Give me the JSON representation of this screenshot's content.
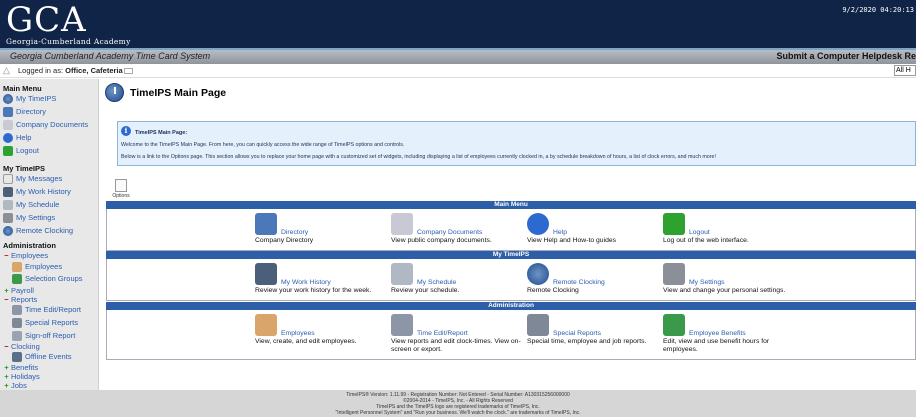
{
  "header": {
    "logo_mark": "GCA",
    "logo_sub": "Georgia-Cumberland Academy",
    "datetime": "9/2/2020 04:20:13",
    "system_title": "Georgia Cumberland Academy Time Card System",
    "helpdesk_link": "Submit a Computer Helpdesk Re"
  },
  "status": {
    "logged_in_prefix": "Logged in as:",
    "logged_in_name": "Office, Cafeteria",
    "filter_value": "All H"
  },
  "sidebar": {
    "main_menu_title": "Main Menu",
    "main_menu": [
      {
        "label": "My TimeIPS",
        "icon": "clock-icon"
      },
      {
        "label": "Directory",
        "icon": "directory-icon"
      },
      {
        "label": "Company Documents",
        "icon": "documents-icon"
      },
      {
        "label": "Help",
        "icon": "help-icon"
      },
      {
        "label": "Logout",
        "icon": "logout-icon"
      }
    ],
    "my_timeips_title": "My TimeIPS",
    "my_timeips": [
      {
        "label": "My Messages",
        "icon": "messages-icon"
      },
      {
        "label": "My Work History",
        "icon": "work-history-icon"
      },
      {
        "label": "My Schedule",
        "icon": "schedule-icon"
      },
      {
        "label": "My Settings",
        "icon": "settings-icon"
      },
      {
        "label": "Remote Clocking",
        "icon": "clock-icon"
      }
    ],
    "admin_title": "Administration",
    "employees": "Employees",
    "employees_sub": "Employees",
    "selection_groups": "Selection Groups",
    "payroll": "Payroll",
    "reports": "Reports",
    "time_edit_report": "Time Edit/Report",
    "special_reports": "Special Reports",
    "signoff_report": "Sign-off Report",
    "clocking": "Clocking",
    "offline_events": "Offline Events",
    "benefits": "Benefits",
    "holidays": "Holidays",
    "jobs": "Jobs"
  },
  "main": {
    "page_title": "TimeIPS Main Page",
    "info_head": "TimeIPS Main Page:",
    "info_line1": "Welcome to the TimeIPS Main Page.  From here, you can quickly access the wide range of TimeIPS options and controls.",
    "info_line2": "Below is a link to the Options page.  This section allows you to replace your home page with a customized set of widgets, including displaying a list of employees currently clocked in, a by schedule breakdown of hours, a list of clock errors, and much more!",
    "options_label": "Options",
    "sections": [
      {
        "title": "Main Menu",
        "tiles": [
          {
            "link": "Directory",
            "desc": "Company Directory",
            "icon": "directory-icon"
          },
          {
            "link": "Company Documents",
            "desc": "View public company documents.",
            "icon": "documents-icon"
          },
          {
            "link": "Help",
            "desc": "View Help and How-to guides",
            "icon": "help-icon"
          },
          {
            "link": "Logout",
            "desc": "Log out of the web interface.",
            "icon": "logout-icon"
          }
        ]
      },
      {
        "title": "My TimeIPS",
        "tiles": [
          {
            "link": "My Work History",
            "desc": "Review your work history for the week.",
            "icon": "work-history-icon"
          },
          {
            "link": "My Schedule",
            "desc": "Review your schedule.",
            "icon": "schedule-icon"
          },
          {
            "link": "Remote Clocking",
            "desc": "Remote Clocking",
            "icon": "clock-icon"
          },
          {
            "link": "My Settings",
            "desc": "View and change your personal settings.",
            "icon": "settings-icon"
          }
        ]
      },
      {
        "title": "Administration",
        "tiles": [
          {
            "link": "Employees",
            "desc": "View, create, and edit employees.",
            "icon": "employees-icon"
          },
          {
            "link": "Time Edit/Report",
            "desc": "View reports and edit clock-times. View on-screen or export.",
            "icon": "time-edit-icon"
          },
          {
            "link": "Special Reports",
            "desc": "Special time, employee and job reports.",
            "icon": "special-reports-icon"
          },
          {
            "link": "Employee Benefits",
            "desc": "Edit, view and use benefit hours for employees.",
            "icon": "benefits-icon"
          }
        ]
      }
    ]
  },
  "footer": {
    "line1": "TimeIPS® Version: 1.11.99 - Registration Number: Not Entered - Serial Number: A130315256000000",
    "line2": "©2004-2014 - TimeIPS, Inc. - All Rights Reserved",
    "line3": "TimeIPS and the TimeIPS logo are registered trademarks of TimeIPS, Inc.",
    "line4": "\"Intelligent Personnel System\" and \"Run your business. We'll watch the clock.\" are trademarks of TimeIPS, Inc."
  },
  "colors": {
    "banner": "#0f2447",
    "band": "#2d5fa8",
    "link": "#2a5db0",
    "sidebar_bg": "#e8e8e8",
    "info_bg": "#e4f0fb"
  }
}
